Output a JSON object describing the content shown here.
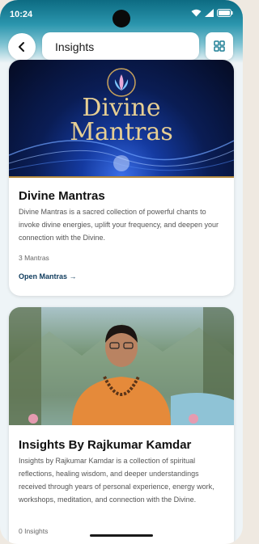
{
  "status_bar": {
    "time": "10:24",
    "icons": [
      "wifi-icon",
      "signal-icon",
      "battery-icon"
    ]
  },
  "header": {
    "title": "Insights",
    "back_icon": "chevron-left-icon",
    "menu_icon": "grid-icon"
  },
  "cards": [
    {
      "banner_text_line1": "Divine",
      "banner_text_line2": "Mantras",
      "title": "Divine Mantras",
      "description": "Divine Mantras is a sacred collection of powerful chants to invoke divine energies, uplift your frequency, and deepen your connection with the Divine.",
      "meta": "3 Mantras",
      "link": "Open Mantras →"
    },
    {
      "title": "Insights By Rajkumar Kamdar",
      "description": "Insights by Rajkumar Kamdar is a collection of spiritual reflections, healing wisdom, and deeper understandings received through years of personal experience, energy work, workshops, meditation, and connection with the Divine.",
      "meta": "0 Insights"
    }
  ],
  "colors": {
    "header_band": "#0d6b82",
    "link": "#0d3a5c",
    "accent_gold": "#c9a35a",
    "grid_icon": "#1e7f95"
  }
}
